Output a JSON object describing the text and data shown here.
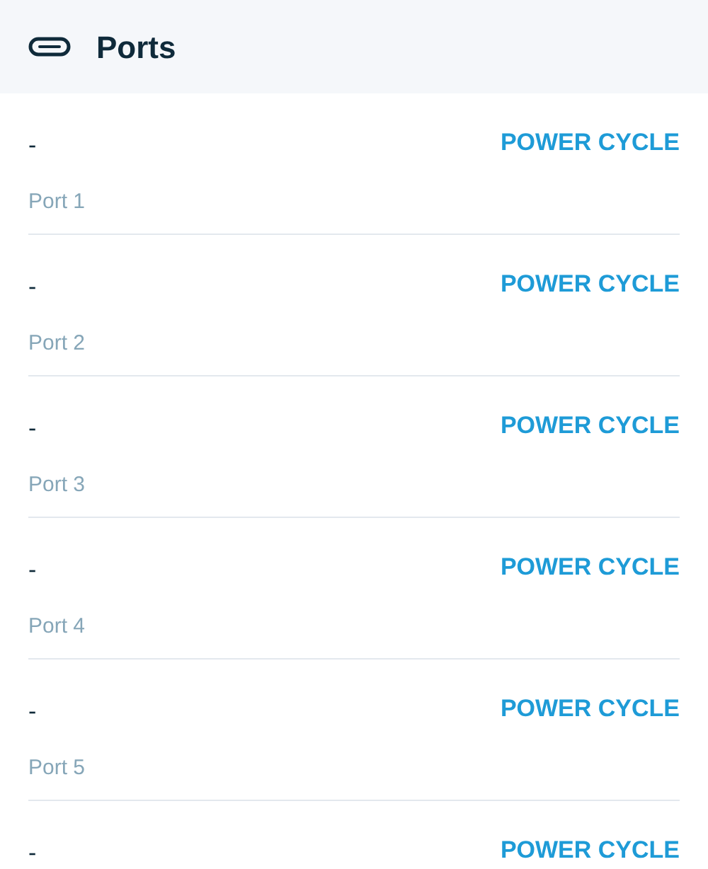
{
  "header": {
    "title": "Ports"
  },
  "ports": [
    {
      "value": "-",
      "action": "POWER CYCLE",
      "label": "Port 1"
    },
    {
      "value": "-",
      "action": "POWER CYCLE",
      "label": "Port 2"
    },
    {
      "value": "-",
      "action": "POWER CYCLE",
      "label": "Port 3"
    },
    {
      "value": "-",
      "action": "POWER CYCLE",
      "label": "Port 4"
    },
    {
      "value": "-",
      "action": "POWER CYCLE",
      "label": "Port 5"
    },
    {
      "value": "-",
      "action": "POWER CYCLE"
    }
  ]
}
